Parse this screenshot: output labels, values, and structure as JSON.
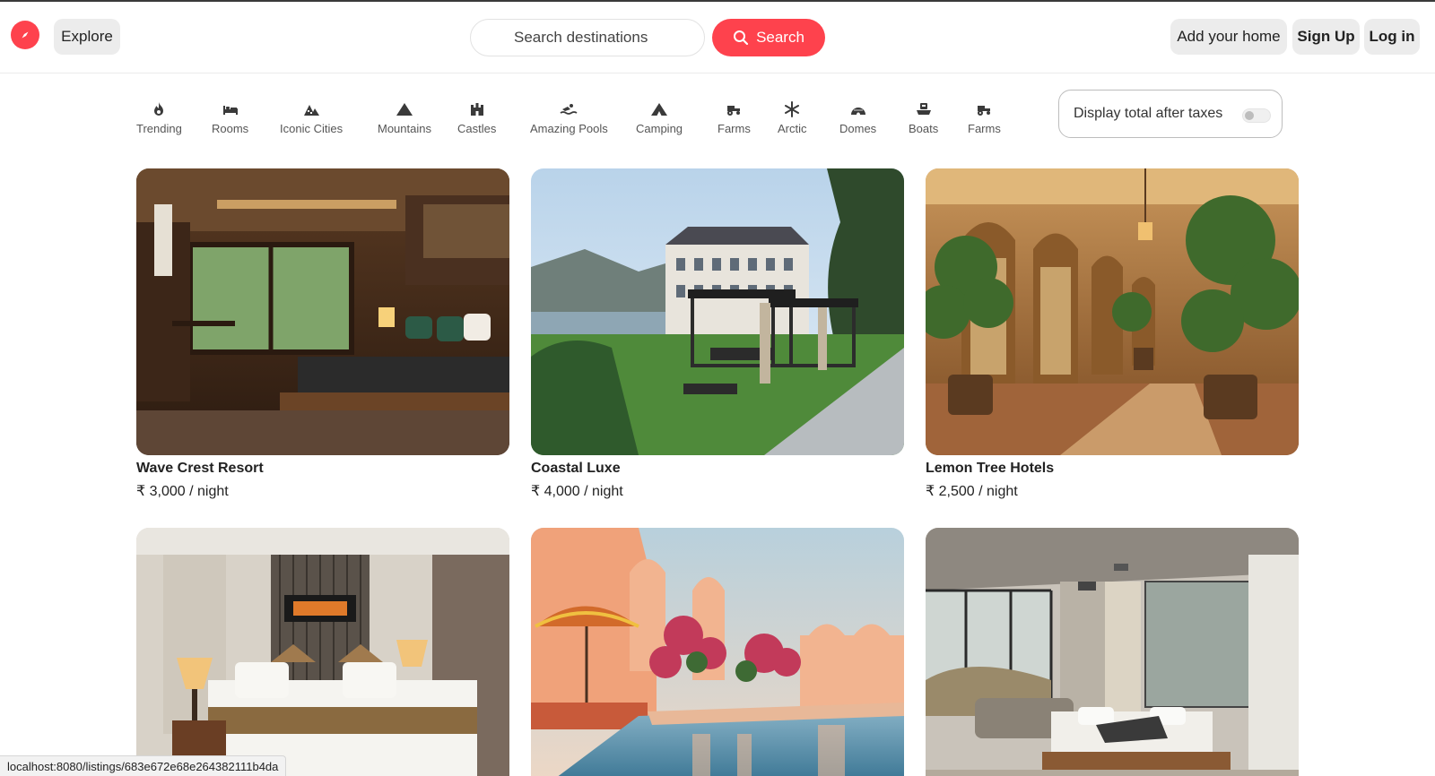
{
  "brand": {
    "accent": "#fe424d",
    "logo_icon": "compass-icon"
  },
  "nav": {
    "explore_label": "Explore",
    "search_placeholder": "Search destinations",
    "search_button_label": "Search",
    "add_home_label": "Add your home",
    "signup_label": "Sign Up",
    "login_label": "Log in"
  },
  "filters": [
    {
      "label": "Trending",
      "icon": "fire-icon"
    },
    {
      "label": "Rooms",
      "icon": "bed-icon"
    },
    {
      "label": "Iconic Cities",
      "icon": "city-icon"
    },
    {
      "label": "Mountains",
      "icon": "mountain-icon"
    },
    {
      "label": "Castles",
      "icon": "castle-icon"
    },
    {
      "label": "Amazing Pools",
      "icon": "swimmer-icon"
    },
    {
      "label": "Camping",
      "icon": "tent-icon"
    },
    {
      "label": "Farms",
      "icon": "tractor-icon"
    },
    {
      "label": "Arctic",
      "icon": "snowflake-icon"
    },
    {
      "label": "Domes",
      "icon": "igloo-icon"
    },
    {
      "label": "Boats",
      "icon": "ship-icon"
    },
    {
      "label": "Farms",
      "icon": "tractor-icon"
    }
  ],
  "taxes_toggle": {
    "label": "Display total after taxes",
    "on": false
  },
  "listings": [
    {
      "title": "Wave Crest Resort",
      "price": "₹ 3,000 / night"
    },
    {
      "title": "Coastal Luxe",
      "price": "₹ 4,000 / night"
    },
    {
      "title": "Lemon Tree Hotels",
      "price": "₹ 2,500 / night"
    },
    {
      "title": "",
      "price": ""
    },
    {
      "title": "",
      "price": ""
    },
    {
      "title": "",
      "price": ""
    }
  ],
  "statusbar": {
    "url": "localhost:8080/listings/683e672e68e264382111b4da"
  }
}
